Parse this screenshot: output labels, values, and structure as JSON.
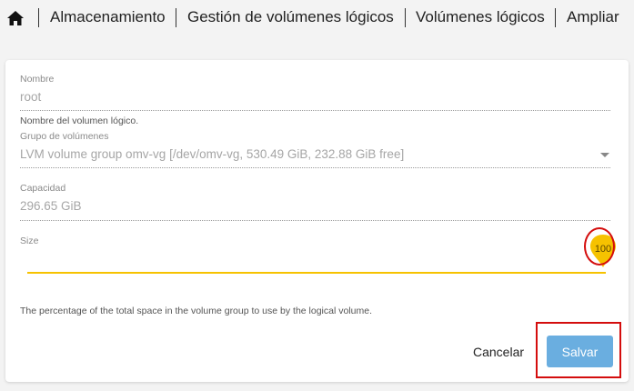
{
  "breadcrumb": {
    "home_icon": "home-icon",
    "items": [
      {
        "label": "Almacenamiento"
      },
      {
        "label": "Gestión de volúmenes lógicos"
      },
      {
        "label": "Volúmenes lógicos"
      },
      {
        "label": "Ampliar"
      }
    ]
  },
  "form": {
    "name": {
      "label": "Nombre",
      "value": "root",
      "hint": "Nombre del volumen lógico."
    },
    "volume_group": {
      "label": "Grupo de volúmenes",
      "value": "LVM volume group omv-vg [/dev/omv-vg, 530.49 GiB, 232.88 GiB free]",
      "icon": "chevron-down-icon"
    },
    "capacity": {
      "label": "Capacidad",
      "value": "296.65 GiB"
    },
    "size": {
      "label": "Size",
      "value": 100,
      "value_label": "100",
      "min": 0,
      "max": 100,
      "hint": "The percentage of the total space in the volume group to use by the logical volume."
    }
  },
  "actions": {
    "cancel_label": "Cancelar",
    "save_label": "Salvar"
  },
  "colors": {
    "slider": "#f6c200",
    "save_button": "#6aaee0",
    "annotation": "#d40d0d"
  }
}
